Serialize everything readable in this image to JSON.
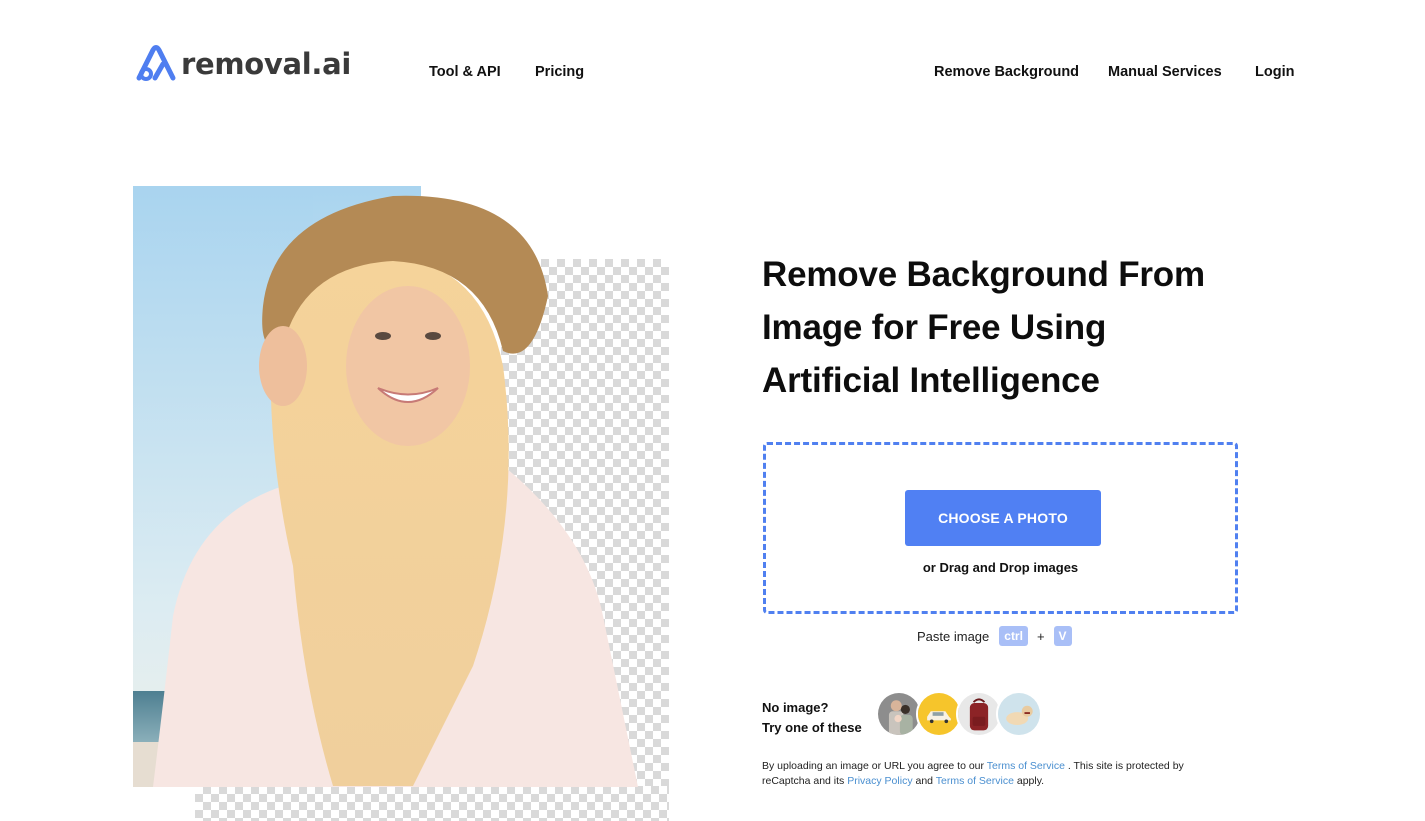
{
  "brand": {
    "name": "removal.ai",
    "accent": "#5080f3",
    "logo_icon": "removal-ai-logo-icon"
  },
  "nav": {
    "left": [
      {
        "label": "Tool & API"
      },
      {
        "label": "Pricing"
      }
    ],
    "right": [
      {
        "label": "Remove Background"
      },
      {
        "label": "Manual Services"
      },
      {
        "label": "Login"
      }
    ]
  },
  "hero": {
    "image_alt": "Smiling woman in straw hat on a beach, with background partially removed showing transparency checkerboard",
    "headline_lines": [
      "Remove Background From",
      "Image for Free Using",
      "Artificial Intelligence"
    ]
  },
  "upload": {
    "button_label": "CHOOSE A PHOTO",
    "drag_text": "or Drag and Drop images",
    "paste_label": "Paste image",
    "paste_keys": [
      "ctrl",
      "V"
    ],
    "plus": "+"
  },
  "samples": {
    "label_line1": "No image?",
    "label_line2": "Try one of these",
    "items": [
      {
        "name": "family",
        "bg": "#8a8a8a"
      },
      {
        "name": "car",
        "bg": "#f4c22a"
      },
      {
        "name": "backpack",
        "bg": "#e6e6e6"
      },
      {
        "name": "dog",
        "bg": "#cfe3ec"
      }
    ]
  },
  "legal": {
    "part1": "By uploading an image or URL you agree to our ",
    "tos_link_1": "Terms of Service",
    "part2": " . This site is protected by reCaptcha and its ",
    "privacy_link": "Privacy Policy",
    "part3": " and ",
    "tos_link_2": "Terms of Service",
    "part4": " apply."
  }
}
